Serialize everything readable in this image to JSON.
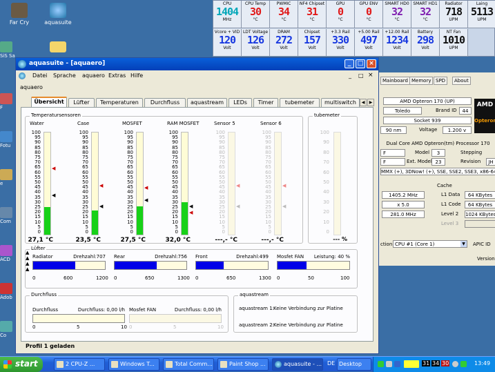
{
  "desktop": {
    "icons_top": [
      {
        "label": "Far Cry"
      },
      {
        "label": "aquasuite"
      }
    ],
    "side_labels": [
      "SiS Sa",
      "F",
      "Fotu",
      "e",
      "Com",
      "ACD",
      "Adob",
      "Co"
    ]
  },
  "meters": [
    {
      "title": "CPU",
      "value": "1404",
      "unit": "MHz",
      "color": "#00a6b8"
    },
    {
      "title": "CPU Temp",
      "value": "30",
      "unit": "°C",
      "color": "#e01818"
    },
    {
      "title": "PWMIC",
      "value": "34",
      "unit": "°C",
      "color": "#e01818"
    },
    {
      "title": "NF4 Chipset",
      "value": "31",
      "unit": "°C",
      "color": "#e01818"
    },
    {
      "title": "GPU",
      "value": "0",
      "unit": "°C",
      "color": "#e01818"
    },
    {
      "title": "GPU ENV",
      "value": "0",
      "unit": "°C",
      "color": "#e01818"
    },
    {
      "title": "SMART HD0",
      "value": "32",
      "unit": "°C",
      "color": "#8020b0"
    },
    {
      "title": "SMART HD1",
      "value": "32",
      "unit": "°C",
      "color": "#8020b0"
    },
    {
      "title": "Radiator",
      "value": "718",
      "unit": "UPM",
      "color": "#101010"
    },
    {
      "title": "Laing",
      "value": "5113",
      "unit": "UPM",
      "color": "#101010"
    },
    {
      "title": "Vcore + VID",
      "value": "120",
      "unit": "Volt",
      "color": "#1838e0"
    },
    {
      "title": "LDT Voltage",
      "value": "126",
      "unit": "Volt",
      "color": "#1838e0"
    },
    {
      "title": "DRAM",
      "value": "272",
      "unit": "Volt",
      "color": "#1838e0"
    },
    {
      "title": "Chipset",
      "value": "157",
      "unit": "Volt",
      "color": "#1838e0"
    },
    {
      "title": "+3.3 Rail",
      "value": "330",
      "unit": "Volt",
      "color": "#1838e0"
    },
    {
      "title": "+5.00 Rail",
      "value": "497",
      "unit": "Volt",
      "color": "#1838e0"
    },
    {
      "title": "+12.00 Rail",
      "value": "1234",
      "unit": "Volt",
      "color": "#1838e0"
    },
    {
      "title": "Battery",
      "value": "298",
      "unit": "Volt",
      "color": "#1838e0"
    },
    {
      "title": "NT Fan",
      "value": "1010",
      "unit": "UPM",
      "color": "#101010"
    }
  ],
  "cpuz": {
    "tabs": [
      "Mainboard",
      "Memory",
      "SPD",
      "About"
    ],
    "name": "AMD Opteron 170 (UP)",
    "codename": "Toledo",
    "brand_label": "Brand ID",
    "brand_id": "44",
    "package": "Socket 939",
    "tech": "90 nm",
    "voltage_label": "Voltage",
    "voltage": "1.200 v",
    "spec": "Dual Core AMD Opteron(tm) Processor 170",
    "family": "F",
    "model_label": "Model",
    "model": "3",
    "stepping_label": "Stepping",
    "ext_family": "F",
    "ext_model_label": "Ext. Model",
    "ext_model": "23",
    "revision_label": "Revision",
    "revision": "JH",
    "instructions": "MMX (+), 3DNow! (+), SSE, SSE2, SSE3, x86-64",
    "cache_label": "Cache",
    "clock": "1405.2 MHz",
    "multiplier": "x 5.0",
    "bus": "281.0 MHz",
    "l1d_label": "L1 Data",
    "l1d": "64 KBytes",
    "l1c_label": "L1 Code",
    "l1c": "64 KBytes",
    "l2_label": "Level 2",
    "l2": "1024 KBytes",
    "l3_label": "Level 3",
    "selection_label": "ction",
    "selection": "CPU #1 (Core 1)",
    "apic_label": "APIC ID",
    "version": "Version",
    "logo": "AMD",
    "logo2": "Opteron"
  },
  "window": {
    "title": "aquasuite - [aquaero]",
    "menu": [
      "Datei",
      "Sprache",
      "aquaero",
      "Extras",
      "Hilfe"
    ],
    "subtitle": "aquaero",
    "tabs": [
      "Übersicht",
      "Lüfter",
      "Temperaturen",
      "Durchfluss",
      "aquastream",
      "LEDs",
      "Timer",
      "tubemeter",
      "multiswitch"
    ],
    "temp_group": "Temperatursensoren",
    "tube_group": "tubemeter",
    "sensors": [
      {
        "name": "Water",
        "value": "27,1 °C",
        "fill": 0.271,
        "active": true
      },
      {
        "name": "Case",
        "value": "23,5 °C",
        "fill": 0.235,
        "active": true
      },
      {
        "name": "MOSFET",
        "value": "27,5 °C",
        "fill": 0.275,
        "active": true
      },
      {
        "name": "RAM MOSFET",
        "value": "32,0 °C",
        "fill": 0.32,
        "active": true
      },
      {
        "name": "Sensor 5",
        "value": "---,- °C",
        "fill": 0,
        "active": false
      },
      {
        "name": "Sensor 6",
        "value": "---,- °C",
        "fill": 0,
        "active": false
      }
    ],
    "scale": [
      "100",
      "95",
      "90",
      "85",
      "80",
      "75",
      "70",
      "65",
      "60",
      "55",
      "50",
      "45",
      "40",
      "35",
      "30",
      "25",
      "20",
      "15",
      "10",
      "5",
      "0"
    ],
    "tube_value": "--- %",
    "fan_group": "Lüfter",
    "fans": [
      {
        "name": "Radiator",
        "reading": "Drehzahl:707",
        "fill": 0.589,
        "ticks": [
          "0",
          "600",
          "1200"
        ]
      },
      {
        "name": "Rear",
        "reading": "Drehzahl:756",
        "fill": 0.582,
        "ticks": [
          "0",
          "650",
          "1300"
        ]
      },
      {
        "name": "Front",
        "reading": "Drehzahl:499",
        "fill": 0.384,
        "ticks": [
          "0",
          "650",
          "1300"
        ]
      },
      {
        "name": "Mosfet FAN",
        "reading": "Leistung: 40 %",
        "fill": 0.4,
        "ticks": [
          "0",
          "50",
          "100"
        ]
      }
    ],
    "flow_group": "Durchfluss",
    "flows": [
      {
        "name": "Durchfluss",
        "reading": "Durchfluss: 0,00 l/h",
        "fill": 0,
        "ticks": [
          "0",
          "5",
          "10"
        ]
      },
      {
        "name": "Mosfet FAN",
        "reading": "Durchfluss: 0,00 l/h",
        "fill": 0,
        "ticks": [
          "0",
          "5",
          "10"
        ]
      }
    ],
    "aquastream_group": "aquastream",
    "aquastreams": [
      {
        "label": "aquastream 1:",
        "status": "Keine Verbindung zur Platine"
      },
      {
        "label": "aquastream 2:",
        "status": "Keine Verbindung zur Platine"
      }
    ],
    "status": "Profil 1 geladen"
  },
  "taskbar": {
    "start": "start",
    "tasks": [
      {
        "label": "2 CPU-Z ..."
      },
      {
        "label": "Windows T..."
      },
      {
        "label": "Total Comm..."
      },
      {
        "label": "Paint Shop ..."
      },
      {
        "label": "aquasuite - ..."
      },
      {
        "label": "Desktop"
      }
    ],
    "lang": "DE",
    "tray_numbers": [
      "31",
      "34",
      "30"
    ],
    "clock": "13:49"
  }
}
